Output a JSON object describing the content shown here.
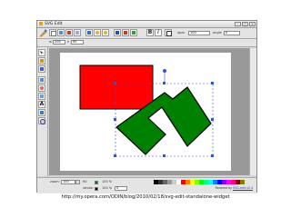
{
  "window": {
    "title": "SVG Edit",
    "min_label": "–",
    "max_label": "□",
    "close_label": "×"
  },
  "toolbar": {
    "icons": [
      "svg-edit-logo-icon",
      "new-icon",
      "select-icon",
      "delete-icon",
      "clone-icon",
      "align-icon",
      "undo-icon",
      "redo-icon",
      "group-icon",
      "move-top-icon",
      "move-bottom-icon",
      "text-bold-icon",
      "text-italic-icon",
      "wireframe-icon"
    ],
    "bold_label": "B",
    "italic_label": "I",
    "opacity_label": "opac",
    "opacity_value": "100",
    "angle_label": "angle",
    "angle_value": "0"
  },
  "subtoolbar": {
    "w_label": "w",
    "w_value": "204",
    "h_label": "h",
    "h_value": "90"
  },
  "left_tools": [
    "select-tool-icon",
    "pencil-tool-icon",
    "line-tool-icon",
    "rect-tool-icon",
    "ellipse-tool-icon",
    "path-tool-icon",
    "text-tool-icon",
    "image-tool-icon",
    "zoom-tool-icon"
  ],
  "canvas": {
    "rect_fill": "#ff0000",
    "poly_fill": "#008000",
    "selection_color": "#3355cc"
  },
  "bottom": {
    "zoom_label": "zoom:",
    "zoom_value": "100",
    "fill_label": "fill:",
    "fill_color": "#008000",
    "fill_opacity": "100 %",
    "stroke_label": "stroke:",
    "stroke_color": "#000000",
    "stroke_opacity": "100 %",
    "stroke_width": "5",
    "palette": [
      "#000000",
      "#333333",
      "#666666",
      "#999999",
      "#cccccc",
      "#ffffff",
      "#ff0000",
      "#ff7f00",
      "#ffff00",
      "#7fff00",
      "#00ff00",
      "#00ff7f",
      "#00ffff",
      "#007fff",
      "#0000ff",
      "#7f00ff",
      "#ff00ff",
      "#ff007f",
      "#7f0000",
      "#7f7f00"
    ],
    "credits_prefix": "Powered by",
    "credits_link": "SVG-edit v2.4"
  },
  "caption": "http://my.opera.com/ODIN/blog/2010/02/18/svg-edit-standalone-widget"
}
